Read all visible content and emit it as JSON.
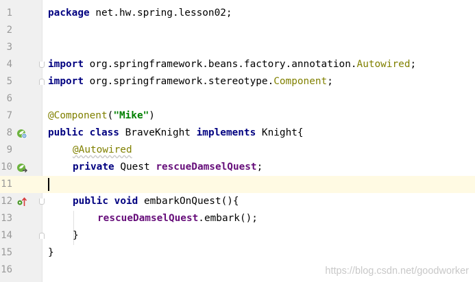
{
  "editor": {
    "line_numbers": [
      "1",
      "2",
      "3",
      "4",
      "5",
      "6",
      "7",
      "8",
      "9",
      "10",
      "11",
      "12",
      "13",
      "14",
      "15",
      "16"
    ],
    "current_line": "11",
    "lines": {
      "l1": {
        "kw": "package",
        "rest": " net.hw.spring.lesson02;"
      },
      "l4": {
        "kw": "import",
        "pkg": " org.springframework.beans.factory.annotation.",
        "cls": "Autowired",
        "end": ";"
      },
      "l5": {
        "kw": "import",
        "pkg": " org.springframework.stereotype.",
        "cls": "Component",
        "end": ";"
      },
      "l7": {
        "ann": "@Component",
        "open": "(",
        "str": "\"Mike\"",
        "close": ")"
      },
      "l8": {
        "kw1": "public",
        "kw2": "class",
        "name": " BraveKnight ",
        "kw3": "implements",
        "rest": " Knight{"
      },
      "l9": {
        "ann": "@Autowired"
      },
      "l10": {
        "kw": "private",
        "type": " Quest ",
        "field": "rescueDamselQuest",
        "end": ";"
      },
      "l12": {
        "kw1": "public",
        "kw2": "void",
        "rest": " embarkOnQuest(){"
      },
      "l13": {
        "field": "rescueDamselQuest",
        "rest": ".embark();"
      },
      "l14": {
        "brace": "}"
      },
      "l15": {
        "brace": "}"
      }
    },
    "gutter_icons": {
      "l8": "spring-bean-icon",
      "l10": "spring-injection-icon",
      "l12": "implementing-method-icon"
    }
  },
  "watermark": "https://blog.csdn.net/goodworker",
  "colors": {
    "keyword": "#000080",
    "annotation": "#808000",
    "string": "#008000",
    "field": "#660e7a",
    "current_line": "#fffae3",
    "gutter": "#f0f0f0"
  }
}
